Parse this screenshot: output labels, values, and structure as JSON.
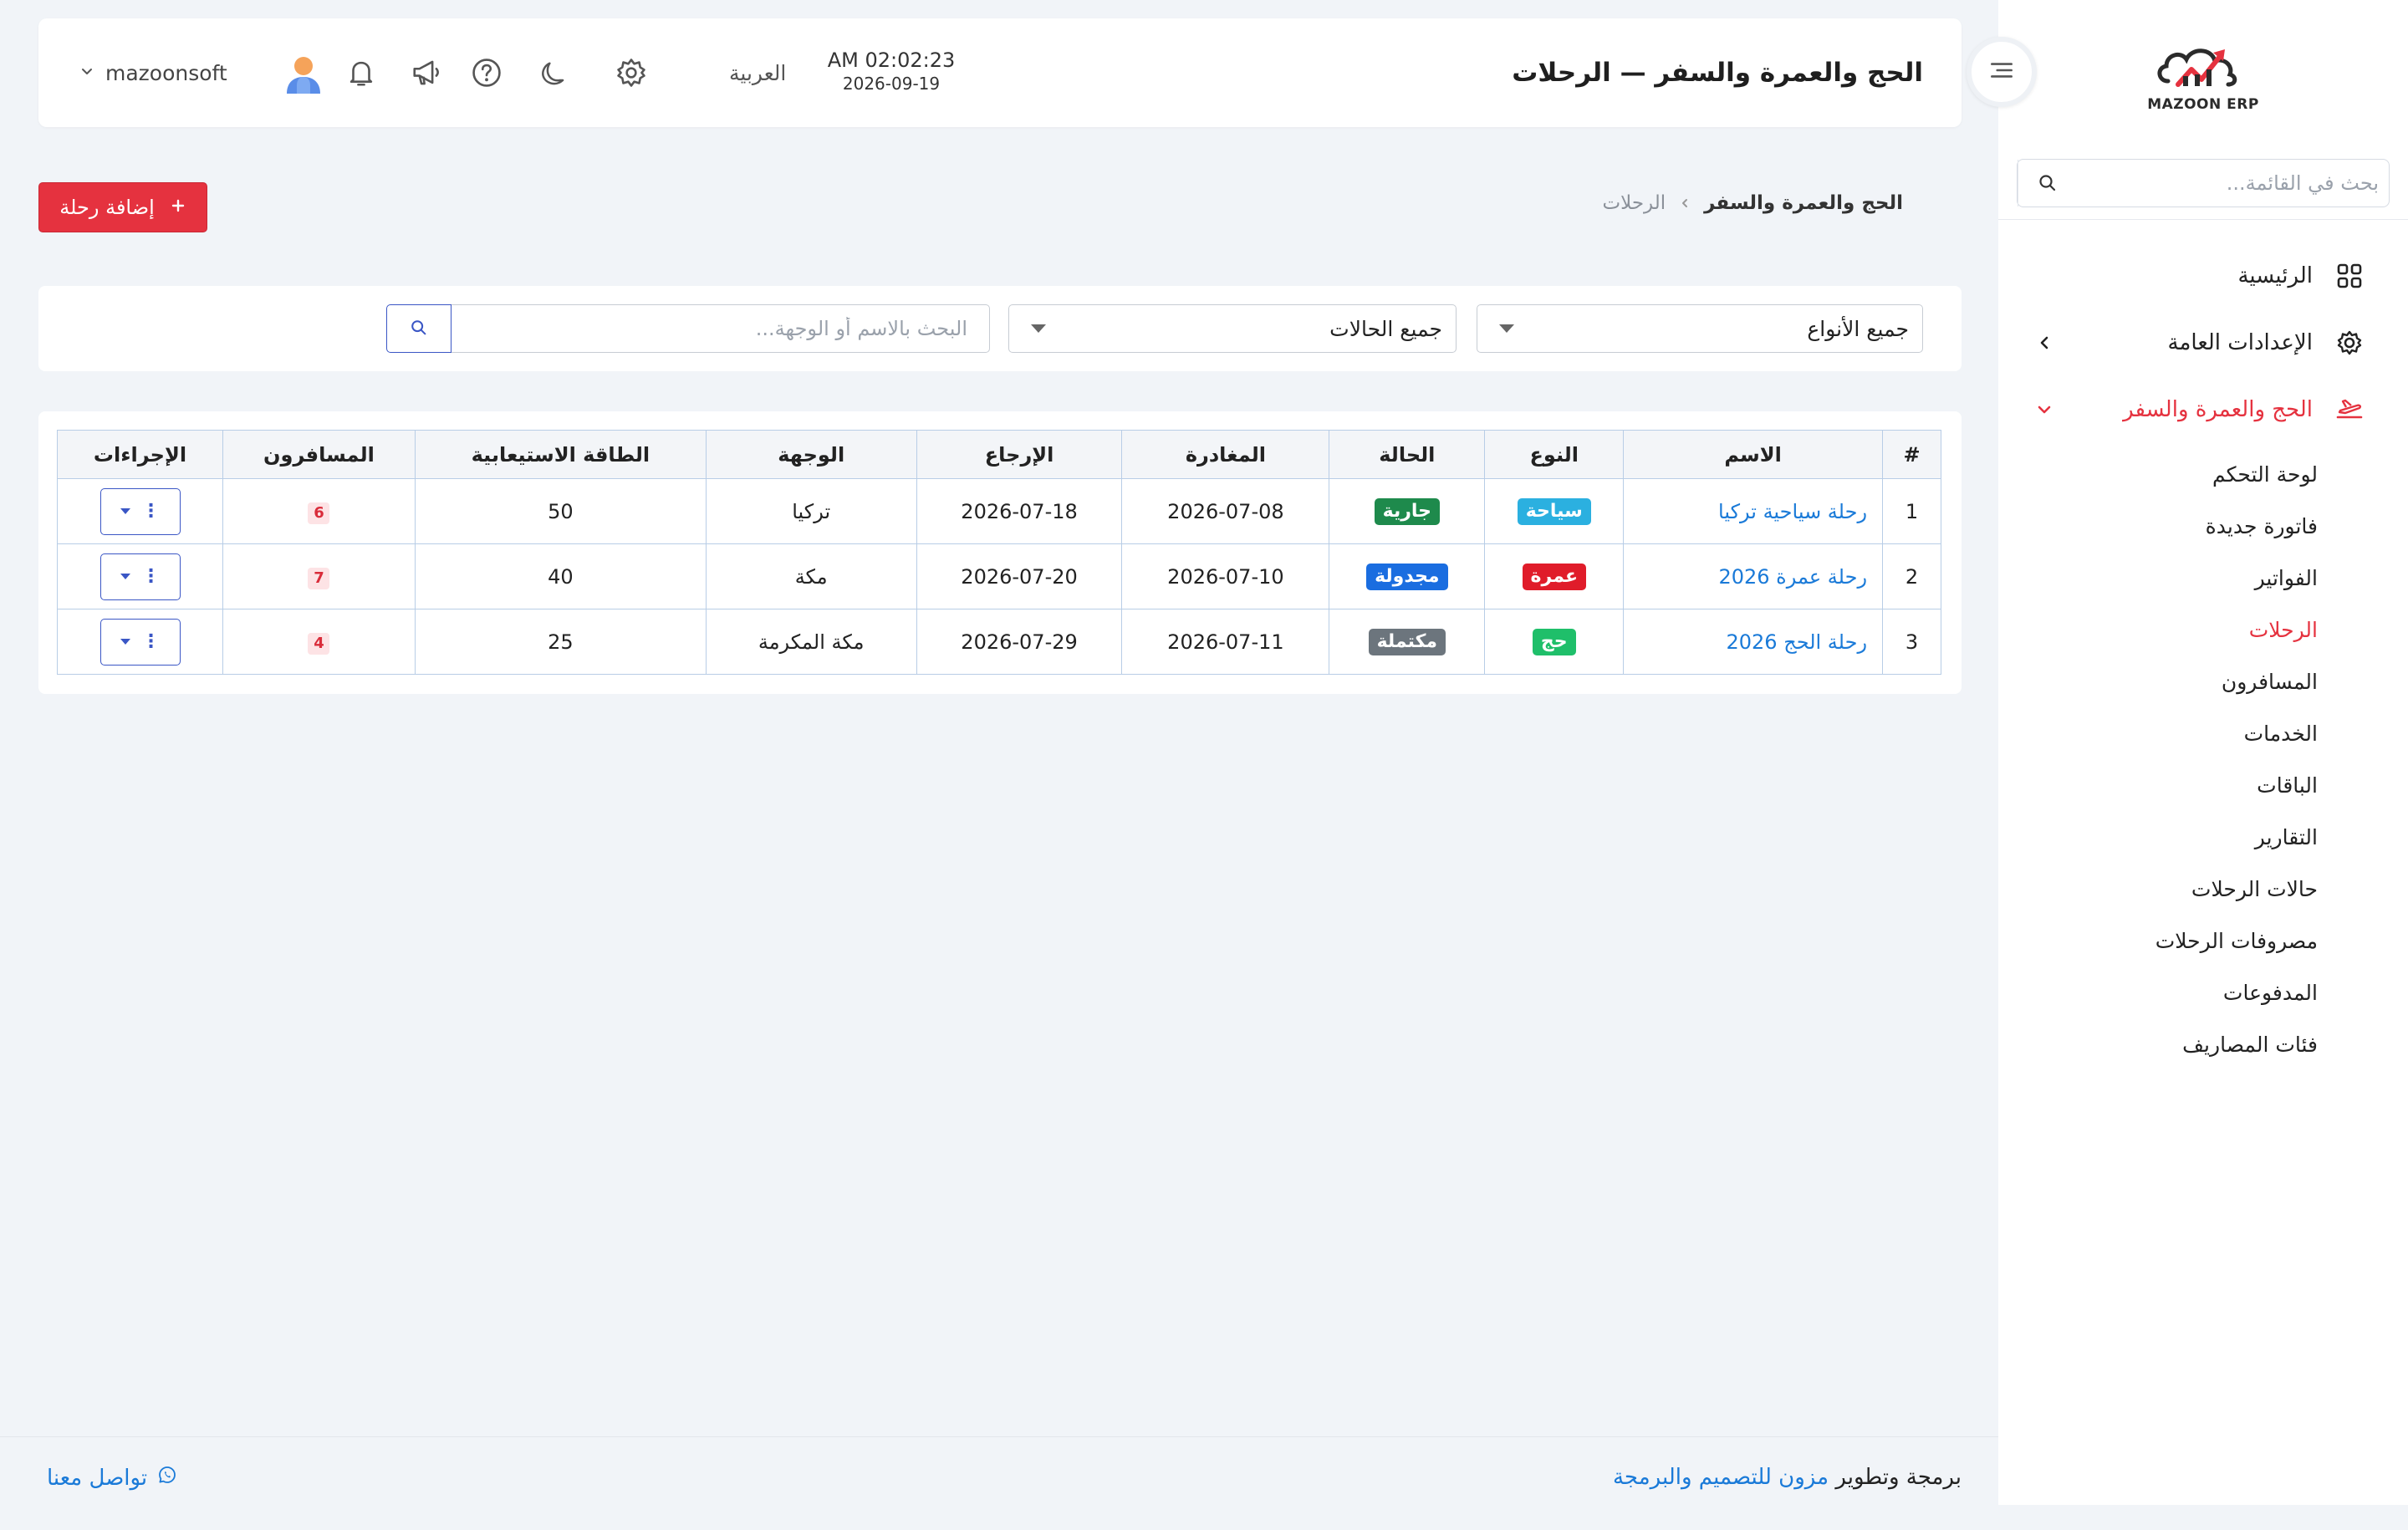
{
  "app": {
    "logo_text": "MAZOON ERP",
    "page_title": "الحج والعمرة والسفر — الرحلات"
  },
  "sidebar": {
    "search_placeholder": "بحث في القائمة...",
    "items": [
      {
        "label": "الرئيسية",
        "icon": "grid-icon"
      },
      {
        "label": "الإعدادات العامة",
        "icon": "gear-icon"
      },
      {
        "label": "الحج والعمرة والسفر",
        "icon": "airplane-icon"
      }
    ],
    "sub_items": [
      {
        "label": "لوحة التحكم"
      },
      {
        "label": "فاتورة جديدة"
      },
      {
        "label": "الفواتير"
      },
      {
        "label": "الرحلات"
      },
      {
        "label": "المسافرون"
      },
      {
        "label": "الخدمات"
      },
      {
        "label": "الباقات"
      },
      {
        "label": "التقارير"
      },
      {
        "label": "حالات الرحلات"
      },
      {
        "label": "مصروفات الرحلات"
      },
      {
        "label": "المدفوعات"
      },
      {
        "label": "فئات المصاريف"
      }
    ]
  },
  "topbar": {
    "time": "AM 02:02:23",
    "date": "2026-09-19",
    "language": "العربية",
    "user_name": "mazoonsoft"
  },
  "breadcrumb": {
    "root": "الحج والعمرة والسفر",
    "current": "الرحلات"
  },
  "actions": {
    "add_trip": "إضافة رحلة"
  },
  "filters": {
    "type_select": "جميع الأنواع",
    "status_select": "جميع الحالات",
    "search_placeholder": "البحث بالاسم أو الوجهة..."
  },
  "table": {
    "headers": [
      "#",
      "الاسم",
      "النوع",
      "الحالة",
      "المغادرة",
      "الإرجاع",
      "الوجهة",
      "الطاقة الاستيعابية",
      "المسافرون",
      "الإجراءات"
    ],
    "rows": [
      {
        "num": "1",
        "name": "رحلة سياحية تركيا",
        "type": "سياحة",
        "status": "جارية",
        "departure": "2026-07-08",
        "return": "2026-07-18",
        "destination": "تركيا",
        "capacity": "50",
        "travelers": "6"
      },
      {
        "num": "2",
        "name": "رحلة عمرة 2026",
        "type": "عمرة",
        "status": "مجدولة",
        "departure": "2026-07-10",
        "return": "2026-07-20",
        "destination": "مكة",
        "capacity": "40",
        "travelers": "7"
      },
      {
        "num": "3",
        "name": "رحلة الحج 2026",
        "type": "حج",
        "status": "مكتملة",
        "departure": "2026-07-11",
        "return": "2026-07-29",
        "destination": "مكة المكرمة",
        "capacity": "25",
        "travelers": "4"
      }
    ]
  },
  "colors": {
    "accent": "#e5323f",
    "link": "#1a7ad8",
    "primary_outline": "#3a56c5",
    "type_tourism": "#2bb0e0",
    "type_umrah": "#e01c2a",
    "type_hajj": "#1fbf6a",
    "status_ongoing": "#1e8a4c",
    "status_scheduled": "#1a6de0",
    "status_completed": "#6c757d"
  },
  "footer": {
    "credit_prefix": "برمجة وتطوير",
    "credit_brand": "مزون للتصميم والبرمجة",
    "contact": "تواصل معنا"
  }
}
